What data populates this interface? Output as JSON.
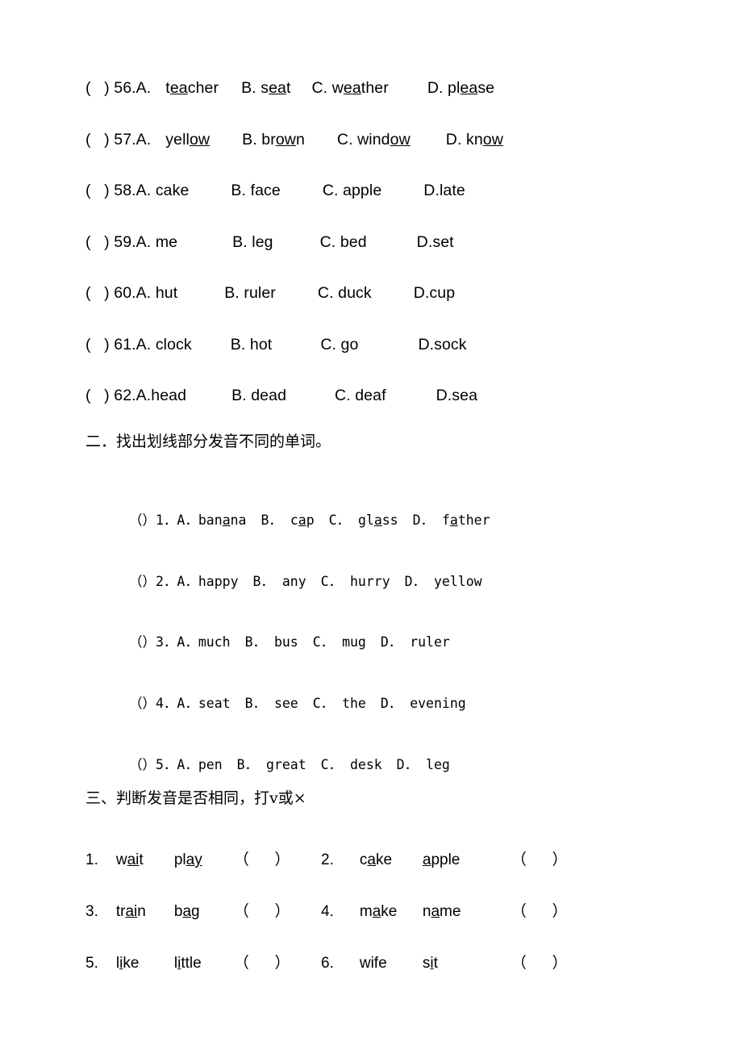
{
  "document": {
    "type": "english-phonics-worksheet",
    "background_color": "#ffffff",
    "text_color": "#000000"
  },
  "section_one": {
    "rows": [
      {
        "prefix": "(   ) 56.A.",
        "options": [
          {
            "letter": "",
            "word_pre": "t",
            "word_underlined": "ea",
            "word_post": "cher",
            "gap": 18
          },
          {
            "letter": "B. ",
            "word_pre": "s",
            "word_underlined": "ea",
            "word_post": "t",
            "gap": 28
          },
          {
            "letter": "C. ",
            "word_pre": "w",
            "word_underlined": "ea",
            "word_post": "ther",
            "gap": 26
          },
          {
            "letter": "D. ",
            "word_pre": "pl",
            "word_underlined": "ea",
            "word_post": "se",
            "gap": 48
          }
        ]
      },
      {
        "prefix": "(   ) 57.A.",
        "options": [
          {
            "letter": "",
            "word_pre": "yell",
            "word_underlined": "ow",
            "word_post": "",
            "gap": 18
          },
          {
            "letter": "B. ",
            "word_pre": "br",
            "word_underlined": "ow",
            "word_post": "n",
            "gap": 40
          },
          {
            "letter": "C. ",
            "word_pre": "wind",
            "word_underlined": "ow",
            "word_post": "",
            "gap": 40
          },
          {
            "letter": "D. ",
            "word_pre": "kn",
            "word_underlined": "ow",
            "word_post": "",
            "gap": 44
          }
        ]
      },
      {
        "prefix": "(   ) 58.A. ",
        "options": [
          {
            "letter": "",
            "word_pre": "cake",
            "word_underlined": "",
            "word_post": "",
            "gap": 0
          },
          {
            "letter": "B. ",
            "word_pre": "face",
            "word_underlined": "",
            "word_post": "",
            "gap": 52
          },
          {
            "letter": "C. ",
            "word_pre": "apple",
            "word_underlined": "",
            "word_post": "",
            "gap": 52
          },
          {
            "letter": "D.",
            "word_pre": "late",
            "word_underlined": "",
            "word_post": "",
            "gap": 52
          }
        ]
      },
      {
        "prefix": "(   ) 59.A. ",
        "options": [
          {
            "letter": "",
            "word_pre": "me",
            "word_underlined": "",
            "word_post": "",
            "gap": 0
          },
          {
            "letter": "B. ",
            "word_pre": "leg",
            "word_underlined": "",
            "word_post": "",
            "gap": 68
          },
          {
            "letter": "C. ",
            "word_pre": "bed",
            "word_underlined": "",
            "word_post": "",
            "gap": 58
          },
          {
            "letter": "D.",
            "word_pre": "set",
            "word_underlined": "",
            "word_post": "",
            "gap": 62
          }
        ]
      },
      {
        "prefix": "(   ) 60.A. ",
        "options": [
          {
            "letter": "",
            "word_pre": "hut",
            "word_underlined": "",
            "word_post": "",
            "gap": 0
          },
          {
            "letter": "B. ",
            "word_pre": "ruler",
            "word_underlined": "",
            "word_post": "",
            "gap": 58
          },
          {
            "letter": "C. ",
            "word_pre": "duck",
            "word_underlined": "",
            "word_post": "",
            "gap": 52
          },
          {
            "letter": "D.",
            "word_pre": "cup",
            "word_underlined": "",
            "word_post": "",
            "gap": 52
          }
        ]
      },
      {
        "prefix": "(   ) 61.A. ",
        "options": [
          {
            "letter": "",
            "word_pre": "clock",
            "word_underlined": "",
            "word_post": "",
            "gap": 0
          },
          {
            "letter": "B. ",
            "word_pre": "hot",
            "word_underlined": "",
            "word_post": "",
            "gap": 48
          },
          {
            "letter": "C. ",
            "word_pre": "go",
            "word_underlined": "",
            "word_post": "",
            "gap": 60
          },
          {
            "letter": "D.",
            "word_pre": "sock",
            "word_underlined": "",
            "word_post": "",
            "gap": 74
          }
        ]
      },
      {
        "prefix": "(   ) 62.A.",
        "options": [
          {
            "letter": "",
            "word_pre": "head",
            "word_underlined": "",
            "word_post": "",
            "gap": 0
          },
          {
            "letter": "B. ",
            "word_pre": "dead",
            "word_underlined": "",
            "word_post": "",
            "gap": 56
          },
          {
            "letter": "C. ",
            "word_pre": "deaf",
            "word_underlined": "",
            "word_post": "",
            "gap": 60
          },
          {
            "letter": "D.",
            "word_pre": "sea",
            "word_underlined": "",
            "word_post": "",
            "gap": 62
          }
        ]
      }
    ]
  },
  "heading_two": "二．找出划线部分发音不同的单词。",
  "section_two": {
    "rows": [
      {
        "prefix": "（）1．A．",
        "options": [
          {
            "letter": "",
            "word_pre": "ban",
            "word_underlined": "a",
            "word_post": "na",
            "gap": 0
          },
          {
            "letter": "B．",
            "word_pre": "c",
            "word_underlined": "a",
            "word_post": "p",
            "gap": 8
          },
          {
            "letter": "C．",
            "word_pre": "gl",
            "word_underlined": "a",
            "word_post": "ss",
            "gap": 8
          },
          {
            "letter": "D．",
            "word_pre": "f",
            "word_underlined": "a",
            "word_post": "ther",
            "gap": 8
          }
        ]
      },
      {
        "prefix": "（）2．A．",
        "options": [
          {
            "letter": "",
            "word_pre": "happy",
            "word_underlined": "",
            "word_post": "",
            "gap": 0
          },
          {
            "letter": "B．",
            "word_pre": "any",
            "word_underlined": "",
            "word_post": "",
            "gap": 8
          },
          {
            "letter": "C．",
            "word_pre": "hurry",
            "word_underlined": "",
            "word_post": "",
            "gap": 8
          },
          {
            "letter": "D．",
            "word_pre": "yellow",
            "word_underlined": "",
            "word_post": "",
            "gap": 8
          }
        ]
      },
      {
        "prefix": "（）3．A．",
        "options": [
          {
            "letter": "",
            "word_pre": "much",
            "word_underlined": "",
            "word_post": "",
            "gap": 0
          },
          {
            "letter": "B．",
            "word_pre": "bus",
            "word_underlined": "",
            "word_post": "",
            "gap": 8
          },
          {
            "letter": "C．",
            "word_pre": "mug",
            "word_underlined": "",
            "word_post": "",
            "gap": 8
          },
          {
            "letter": "D．",
            "word_pre": "ruler",
            "word_underlined": "",
            "word_post": "",
            "gap": 8
          }
        ]
      },
      {
        "prefix": "（）4．A．",
        "options": [
          {
            "letter": "",
            "word_pre": "seat",
            "word_underlined": "",
            "word_post": "",
            "gap": 0
          },
          {
            "letter": "B．",
            "word_pre": "see",
            "word_underlined": "",
            "word_post": "",
            "gap": 8
          },
          {
            "letter": "C．",
            "word_pre": "the",
            "word_underlined": "",
            "word_post": "",
            "gap": 8
          },
          {
            "letter": "D．",
            "word_pre": "evening",
            "word_underlined": "",
            "word_post": "",
            "gap": 8
          }
        ]
      },
      {
        "prefix": "（）5．A．",
        "options": [
          {
            "letter": "",
            "word_pre": "pen",
            "word_underlined": "",
            "word_post": "",
            "gap": 0
          },
          {
            "letter": "B．",
            "word_pre": "great",
            "word_underlined": "",
            "word_post": "",
            "gap": 8
          },
          {
            "letter": "C．",
            "word_pre": "desk",
            "word_underlined": "",
            "word_post": "",
            "gap": 8
          },
          {
            "letter": "D．",
            "word_pre": "leg",
            "word_underlined": "",
            "word_post": "",
            "gap": 8
          }
        ]
      }
    ]
  },
  "heading_three": "三、判断发音是否相同，打v或×",
  "section_three": {
    "paren_mark": "（      ）",
    "rows": [
      {
        "left": {
          "number": "1.",
          "word_one": {
            "pre": "w",
            "underlined": "ai",
            "post": "t"
          },
          "word_two": {
            "pre": "pl",
            "underlined": "ay",
            "post": ""
          }
        },
        "right": {
          "number": "2.",
          "word_one": {
            "pre": "c",
            "underlined": "a",
            "post": "ke"
          },
          "word_two": {
            "pre": "",
            "underlined": "a",
            "post": "pple"
          }
        }
      },
      {
        "left": {
          "number": "3.",
          "word_one": {
            "pre": "tr",
            "underlined": "ai",
            "post": "n"
          },
          "word_two": {
            "pre": "b",
            "underlined": "a",
            "post": "g"
          }
        },
        "right": {
          "number": "4.",
          "word_one": {
            "pre": "m",
            "underlined": "a",
            "post": "ke"
          },
          "word_two": {
            "pre": "n",
            "underlined": "a",
            "post": "me"
          }
        }
      },
      {
        "left": {
          "number": "5.",
          "word_one": {
            "pre": "l",
            "underlined": "i",
            "post": "ke"
          },
          "word_two": {
            "pre": "l",
            "underlined": "i",
            "post": "ttle"
          }
        },
        "right": {
          "number": "6.",
          "word_one": {
            "pre": "wife",
            "underlined": "",
            "post": ""
          },
          "word_two": {
            "pre": "s",
            "underlined": "i",
            "post": "t"
          }
        }
      }
    ]
  }
}
